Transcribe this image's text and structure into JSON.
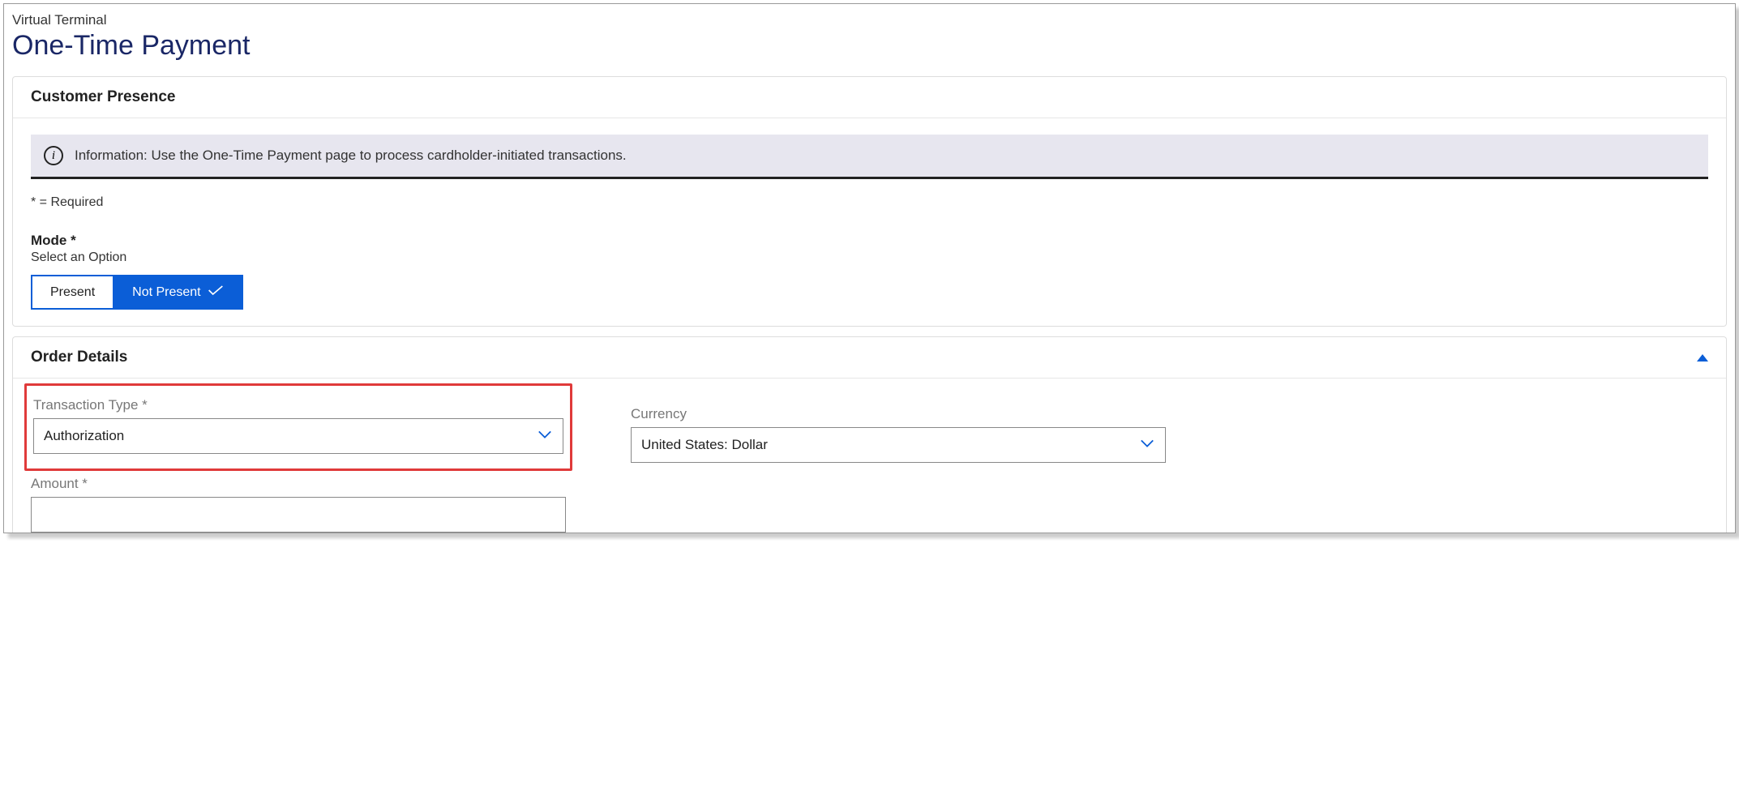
{
  "header": {
    "breadcrumb": "Virtual Terminal",
    "title": "One-Time Payment"
  },
  "customer_presence": {
    "heading": "Customer Presence",
    "info_text": "Information: Use the One-Time Payment page to process cardholder-initiated transactions.",
    "required_note": "* = Required",
    "mode_label": "Mode *",
    "mode_hint": "Select an Option",
    "option_present": "Present",
    "option_not_present": "Not Present"
  },
  "order_details": {
    "heading": "Order Details",
    "transaction_type_label": "Transaction Type *",
    "transaction_type_value": "Authorization",
    "currency_label": "Currency",
    "currency_value": "United States: Dollar",
    "amount_label": "Amount *",
    "amount_value": ""
  }
}
